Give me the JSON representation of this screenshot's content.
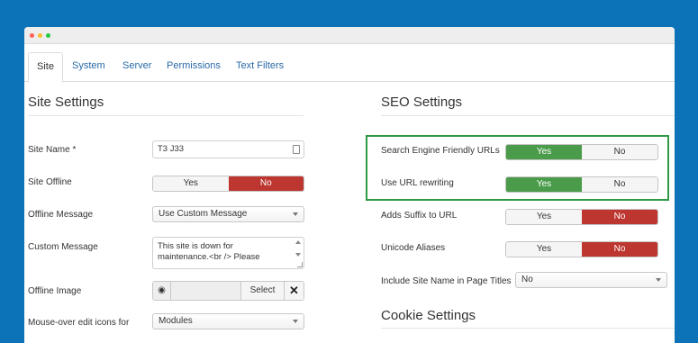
{
  "window": {
    "dots": [
      {
        "name": "close-dot",
        "color": "#ff5f56"
      },
      {
        "name": "minimize-dot",
        "color": "#ffbd2e"
      },
      {
        "name": "maximize-dot",
        "color": "#27c93f"
      }
    ]
  },
  "tabs": [
    "Site",
    "System",
    "Server",
    "Permissions",
    "Text Filters"
  ],
  "site_settings": {
    "title": "Site Settings",
    "site_name_label": "Site Name *",
    "site_name_value": "T3 J33",
    "site_offline_label": "Site Offline",
    "site_offline_yes": "Yes",
    "site_offline_no": "No",
    "offline_message_label": "Offline Message",
    "offline_message_value": "Use Custom Message",
    "custom_message_label": "Custom Message",
    "custom_message_line1": "This site is down for",
    "custom_message_line2": "maintenance.<br /> Please",
    "offline_image_label": "Offline Image",
    "select_label": "Select",
    "mouseover_label": "Mouse-over edit icons for",
    "mouseover_value": "Modules"
  },
  "seo_settings": {
    "title": "SEO Settings",
    "sef_label": "Search Engine Friendly URLs",
    "url_rewriting_label": "Use URL rewriting",
    "suffix_label": "Adds Suffix to URL",
    "unicode_label": "Unicode Aliases",
    "include_site_name_label": "Include Site Name in Page Titles",
    "include_site_name_value": "No",
    "yes": "Yes",
    "no": "No",
    "highlight_color": "#2e9a46"
  },
  "cookie_settings": {
    "title": "Cookie Settings"
  },
  "colors": {
    "background": "#0c73b8",
    "yes_active": "#4a9c4a",
    "no_active": "#bd362f",
    "link": "#2a6aa8"
  }
}
